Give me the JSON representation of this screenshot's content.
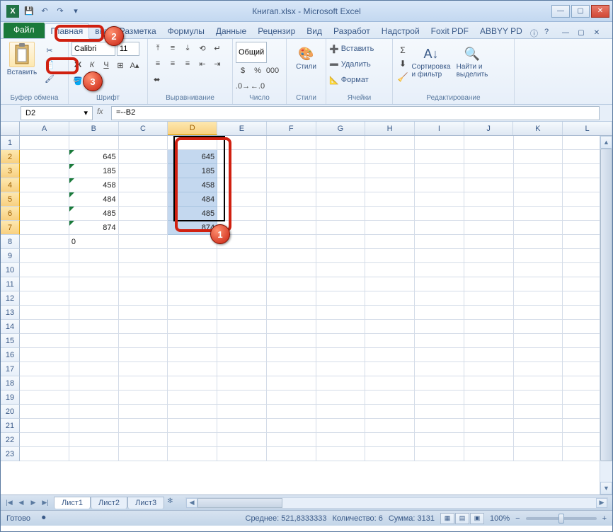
{
  "title": "Книгап.xlsx - Microsoft Excel",
  "qat": {
    "save": "💾",
    "undo": "↶",
    "redo": "↷",
    "down": "▾"
  },
  "win": {
    "min": "—",
    "max": "▢",
    "close": "✕"
  },
  "tabs": {
    "file": "Файл",
    "home": "Главная",
    "t2": "вка",
    "t3": "Разметка",
    "t4": "Формулы",
    "t5": "Данные",
    "t6": "Рецензир",
    "t7": "Вид",
    "t8": "Разработ",
    "t9": "Надстрой",
    "t10": "Foxit PDF",
    "t11": "ABBYY PD"
  },
  "ribbon": {
    "clipboard": {
      "label": "Буфер обмена",
      "paste": "Вставить",
      "cut": "✂",
      "copy": "📄"
    },
    "font": {
      "label": "Шрифт",
      "name": "Calibri",
      "size": "11",
      "bold": "Ж",
      "italic": "К",
      "under": "Ч"
    },
    "align": {
      "label": "Выравнивание"
    },
    "number": {
      "label": "Число",
      "fmt": "Общий"
    },
    "styles": {
      "label": "Стили",
      "btn": "Стили"
    },
    "cells": {
      "label": "Ячейки",
      "insert": "Вставить",
      "delete": "Удалить",
      "format": "Формат"
    },
    "editing": {
      "label": "Редактирование",
      "sort": "Сортировка\nи фильтр",
      "find": "Найти и\nвыделить"
    }
  },
  "formula_bar": {
    "name_box": "D2",
    "formula": "=--B2"
  },
  "columns": [
    "A",
    "B",
    "C",
    "D",
    "E",
    "F",
    "G",
    "H",
    "I",
    "J",
    "K",
    "L"
  ],
  "rows": [
    1,
    2,
    3,
    4,
    5,
    6,
    7,
    8,
    9,
    10,
    11,
    12,
    13,
    14,
    15,
    16,
    17,
    18,
    19,
    20,
    21,
    22,
    23
  ],
  "data_b": [
    "645",
    "185",
    "458",
    "484",
    "485",
    "874"
  ],
  "data_d": [
    "645",
    "185",
    "458",
    "484",
    "485",
    "874"
  ],
  "b8": "0",
  "sheets": {
    "s1": "Лист1",
    "s2": "Лист2",
    "s3": "Лист3"
  },
  "status": {
    "ready": "Готово",
    "avg": "Среднее: 521,8333333",
    "count": "Количество: 6",
    "sum": "Сумма: 3131",
    "zoom": "100%"
  },
  "marks": {
    "m1": "1",
    "m2": "2",
    "m3": "3"
  }
}
